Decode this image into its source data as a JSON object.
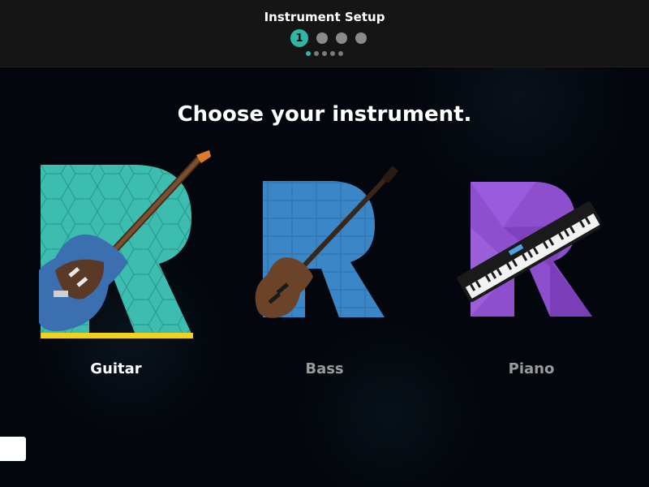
{
  "header": {
    "title": "Instrument Setup",
    "current_step": "1",
    "total_steps": 4,
    "pager_count": 5,
    "pager_active_index": 0
  },
  "main": {
    "heading": "Choose your instrument."
  },
  "instruments": [
    {
      "label": "Guitar",
      "selected": true,
      "color": "#3dbdb0",
      "label_color": "#ffffff"
    },
    {
      "label": "Bass",
      "selected": false,
      "color": "#3a86c6",
      "label_color": "#9a9a9a"
    },
    {
      "label": "Piano",
      "selected": false,
      "color": "#8e4fcf",
      "label_color": "#9a9a9a"
    }
  ],
  "colors": {
    "accent": "#2fb7a4",
    "selected_underline": "#f0d21a"
  },
  "icons": [
    "guitar-icon",
    "bass-icon",
    "piano-icon"
  ]
}
